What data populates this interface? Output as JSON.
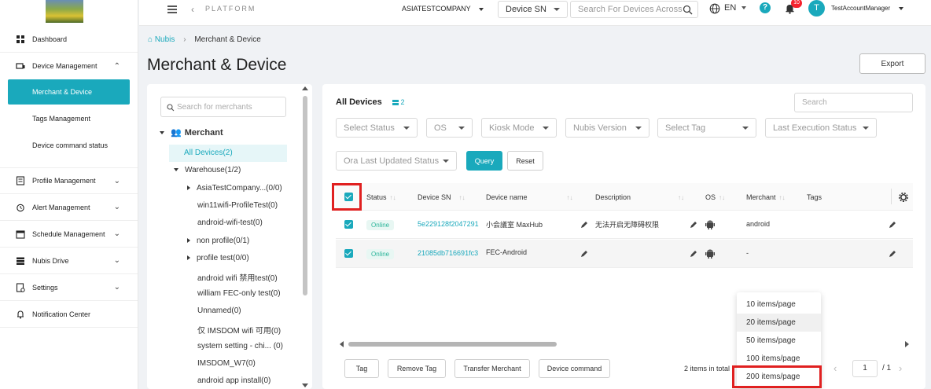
{
  "topbar": {
    "platform": "PLATFORM",
    "company": "ASIATESTCOMPANY",
    "search_type": "Device SN",
    "search_placeholder": "Search For Devices Across",
    "language": "EN",
    "notifications": "10",
    "avatar": "T",
    "user": "TestAccountManager"
  },
  "sidebar": {
    "items": [
      {
        "label": "Dashboard"
      },
      {
        "label": "Device Management"
      },
      {
        "label": "Merchant & Device"
      },
      {
        "label": "Tags Management"
      },
      {
        "label": "Device command status"
      },
      {
        "label": "Profile Management"
      },
      {
        "label": "Alert Management"
      },
      {
        "label": "Schedule Management"
      },
      {
        "label": "Nubis Drive"
      },
      {
        "label": "Settings"
      },
      {
        "label": "Notification Center"
      }
    ]
  },
  "breadcrumb": {
    "root": "Nubis",
    "current": "Merchant & Device"
  },
  "page_title": "Merchant & Device",
  "export_label": "Export",
  "tree": {
    "search_placeholder": "Search for merchants",
    "root": "Merchant",
    "items": [
      "All Devices(2)",
      "Warehouse(1/2)",
      "AsiaTestCompany...(0/0)",
      "win11wifi-ProfileTest(0)",
      "android-wifi-test(0)",
      "non profile(0/1)",
      "profile test(0/0)",
      "android wifi 禁用test(0)",
      "william FEC-only test(0)",
      "Unnamed(0)",
      "仅 IMSDOM wifi 可用(0)",
      "system setting - chi...  (0)",
      "IMSDOM_W7(0)",
      "android app install(0)"
    ]
  },
  "devices": {
    "title": "All Devices",
    "count": "2",
    "search_placeholder": "Search",
    "filters": {
      "status": "Select Status",
      "os": "OS",
      "kiosk": "Kiosk Mode",
      "nubis_version": "Nubis Version",
      "tag": "Select Tag",
      "last_exec": "Last Execution Status",
      "ora": "Ora Last Updated Status"
    },
    "query_label": "Query",
    "reset_label": "Reset",
    "columns": [
      "Status",
      "Device SN",
      "Device name",
      "Description",
      "OS",
      "Merchant",
      "Tags"
    ],
    "rows": [
      {
        "status": "Online",
        "sn": "5e229128f2047291",
        "name": "小会議室 MaxHub",
        "description": "无法开启无障碍权限",
        "merchant": "android"
      },
      {
        "status": "Online",
        "sn": "21085db716691fc3",
        "name": "FEC-Android",
        "description": "",
        "merchant": "-"
      }
    ],
    "actions": [
      "Tag",
      "Remove Tag",
      "Transfer Merchant",
      "Device command"
    ],
    "total": "2 items in total",
    "page": "1",
    "pages": "/ 1",
    "page_size_options": [
      "10 items/page",
      "20 items/page",
      "50 items/page",
      "100 items/page",
      "200 items/page"
    ]
  },
  "colors": {
    "accent": "#1aa9bc",
    "highlight": "#e02020",
    "online": "#2bb59a"
  }
}
